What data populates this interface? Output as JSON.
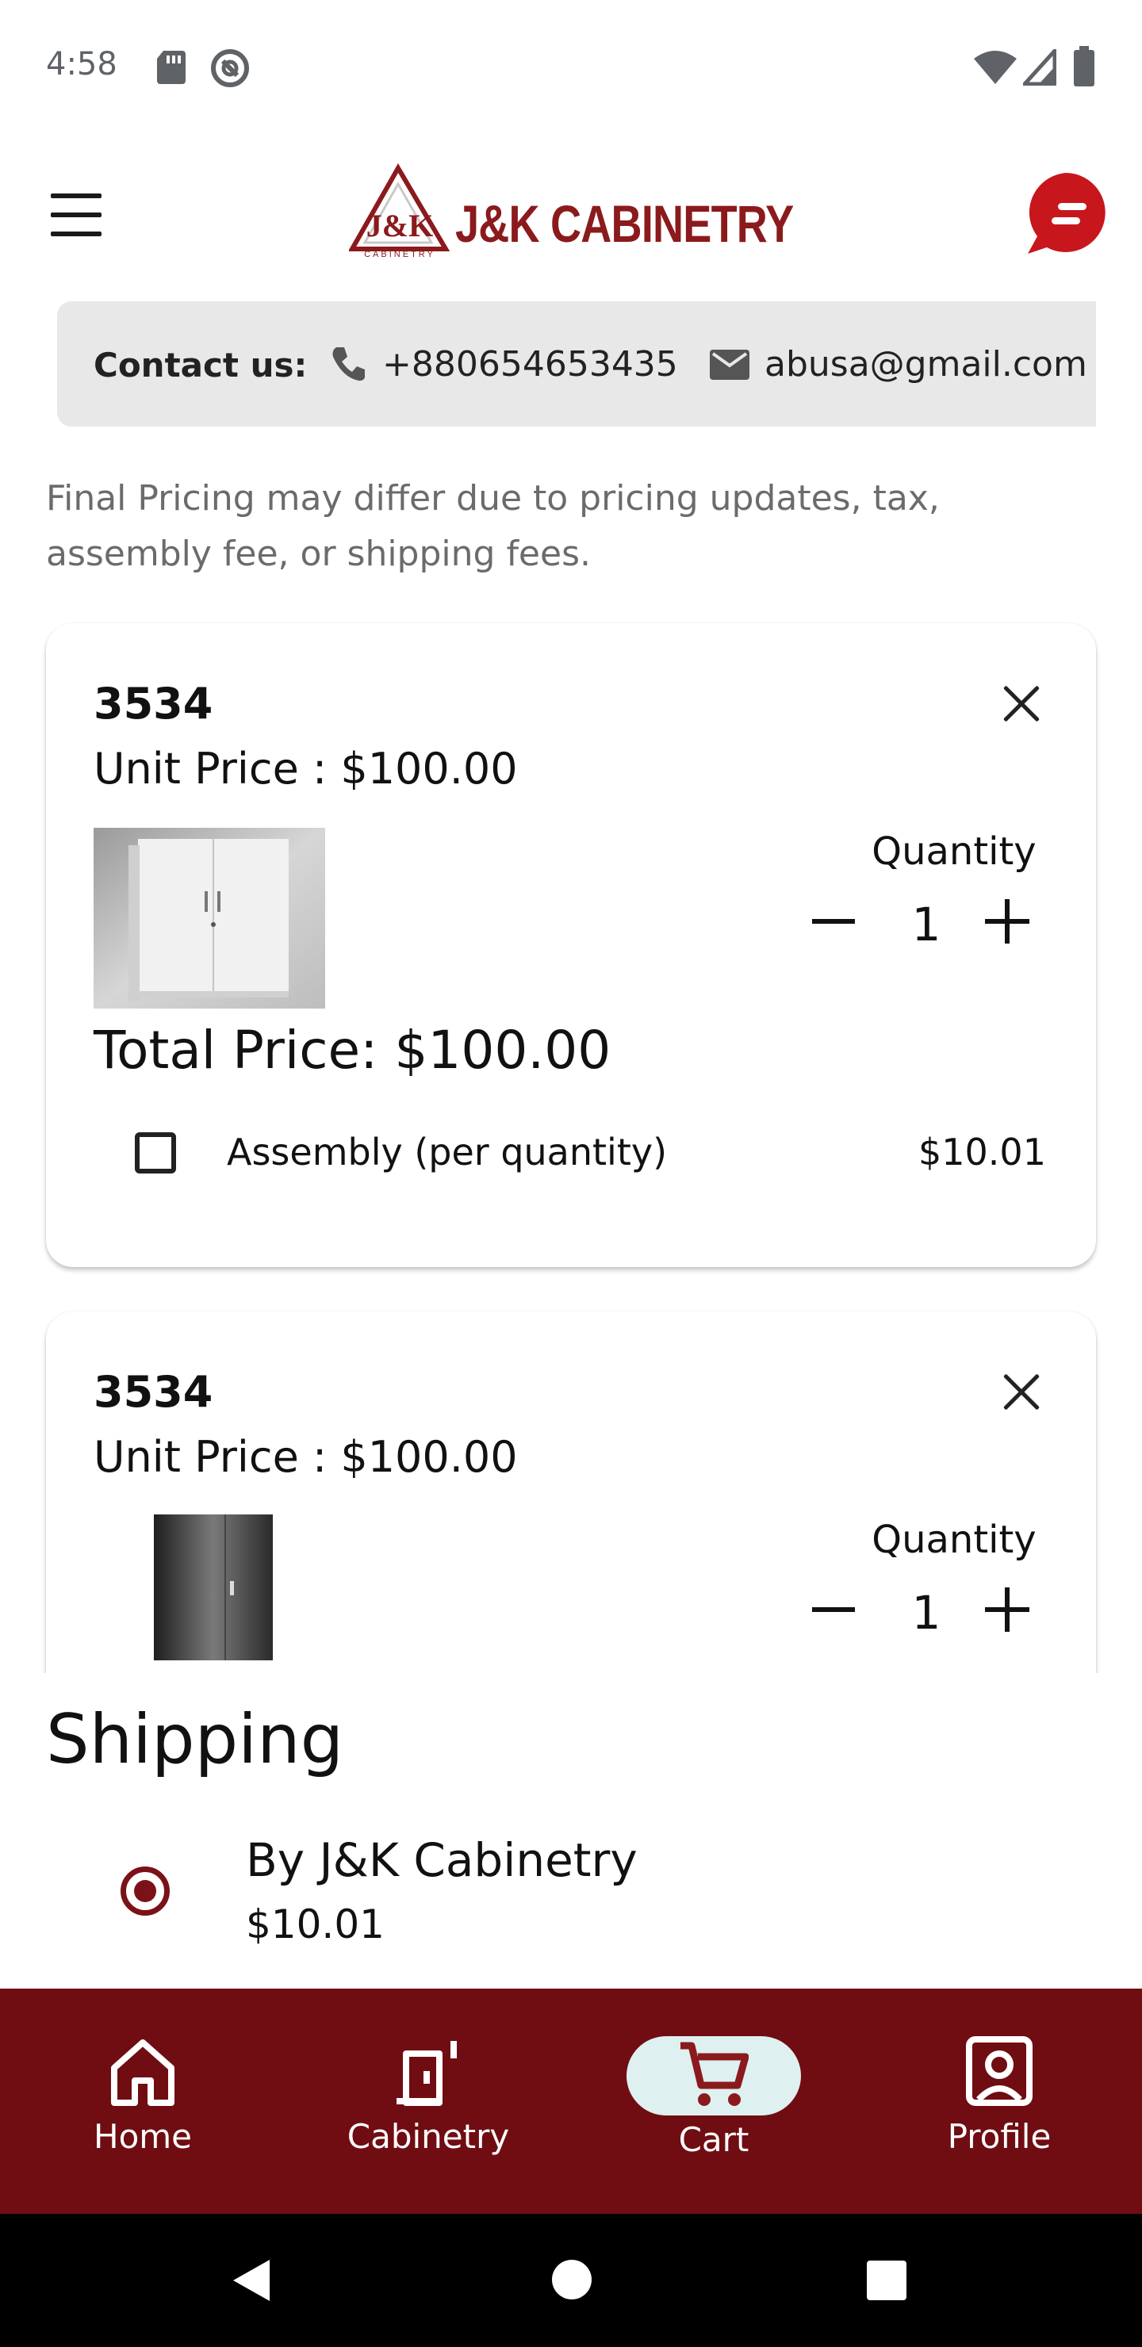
{
  "status_bar": {
    "time": "4:58",
    "icons_left": [
      "sd-card-icon",
      "do-not-disturb-icon"
    ],
    "icons_right": [
      "wifi-icon",
      "signal-icon",
      "battery-icon"
    ]
  },
  "header": {
    "brand_name": "J&K CABINETRY",
    "logo_mark_text": "J&K",
    "logo_sub_text": "CABINETRY",
    "menu_icon": "hamburger-menu-icon",
    "chat_icon": "chat-bubble-icon",
    "brand_color": "#8b1a1d"
  },
  "contact": {
    "label": "Contact us:",
    "phone": "+880654653435",
    "email": "abusa@gmail.com"
  },
  "disclaimer": "Final Pricing may differ due to pricing updates, tax, assembly fee, or shipping fees.",
  "cart_items": [
    {
      "name": "3534",
      "unit_price": "Unit Price : $100.00",
      "quantity_label": "Quantity",
      "quantity": "1",
      "total_price": "Total Price: $100.00",
      "assembly_label": "Assembly (per quantity)",
      "assembly_price": "$10.01",
      "assembly_checked": false,
      "image": "white-cabinet-image"
    },
    {
      "name": "3534",
      "unit_price": "Unit Price : $100.00",
      "quantity_label": "Quantity",
      "quantity": "1",
      "image": "black-cabinet-image"
    }
  ],
  "shipping": {
    "title": "Shipping",
    "option_name": "By J&K Cabinetry",
    "option_price": "$10.01",
    "selected": true
  },
  "bottom_nav": {
    "items": [
      {
        "label": "Home",
        "icon": "home-icon"
      },
      {
        "label": "Cabinetry",
        "icon": "cabinet-icon"
      },
      {
        "label": "Cart",
        "icon": "cart-icon"
      },
      {
        "label": "Profile",
        "icon": "profile-icon"
      }
    ],
    "active_index": 2,
    "background": "#700d12",
    "active_pill_color": "#dff0f0"
  },
  "system_nav": {
    "icons": [
      "back-icon",
      "home-circle-icon",
      "recents-icon"
    ]
  }
}
